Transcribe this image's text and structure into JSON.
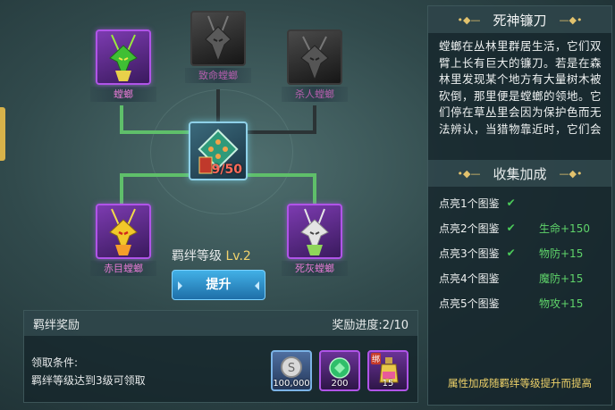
{
  "nodes": {
    "mantis": {
      "label": "螳螂"
    },
    "deadly_mantis": {
      "label": "致命螳螂"
    },
    "killer_mantis": {
      "label": "杀人螳螂"
    },
    "redeye_mantis": {
      "label": "赤目螳螂"
    },
    "ash_mantis": {
      "label": "死灰螳螂"
    }
  },
  "center": {
    "progress": "9/50"
  },
  "bond": {
    "label": "羁绊等级",
    "level": "Lv.2",
    "upgrade_label": "提升"
  },
  "reward": {
    "title": "羁绊奖励",
    "progress_label": "奖励进度:2/10",
    "condition_title": "领取条件:",
    "condition_text": "羁绊等级达到3级可领取",
    "items": [
      {
        "name": "silver",
        "qty": "100,000"
      },
      {
        "name": "gem",
        "qty": "200"
      },
      {
        "name": "potion",
        "qty": "15",
        "tag": "绑"
      }
    ]
  },
  "info": {
    "title": "死神镰刀",
    "description": "螳螂在丛林里群居生活，它们双臂上长有巨大的镰刀。若是在森林里发现某个地方有大量树木被砍倒，那里便是螳螂的领地。它们停在草丛里会因为保护色而无法辨认，当猎物靠近时，它们会",
    "collection_title": "收集加成",
    "rows": [
      {
        "label": "点亮1个图鉴",
        "checked": true,
        "bonus": ""
      },
      {
        "label": "点亮2个图鉴",
        "checked": true,
        "bonus": "生命+150"
      },
      {
        "label": "点亮3个图鉴",
        "checked": true,
        "bonus": "物防+15"
      },
      {
        "label": "点亮4个图鉴",
        "checked": false,
        "bonus": "魔防+15"
      },
      {
        "label": "点亮5个图鉴",
        "checked": false,
        "bonus": "物攻+15"
      }
    ],
    "footer": "属性加成随羁绊等级提升而提高"
  },
  "colors": {
    "accent_gold": "#f0d36a",
    "bonus_green": "#5fd46a",
    "progress_red": "#ff6b5a",
    "rare_purple": "#b054e8"
  }
}
